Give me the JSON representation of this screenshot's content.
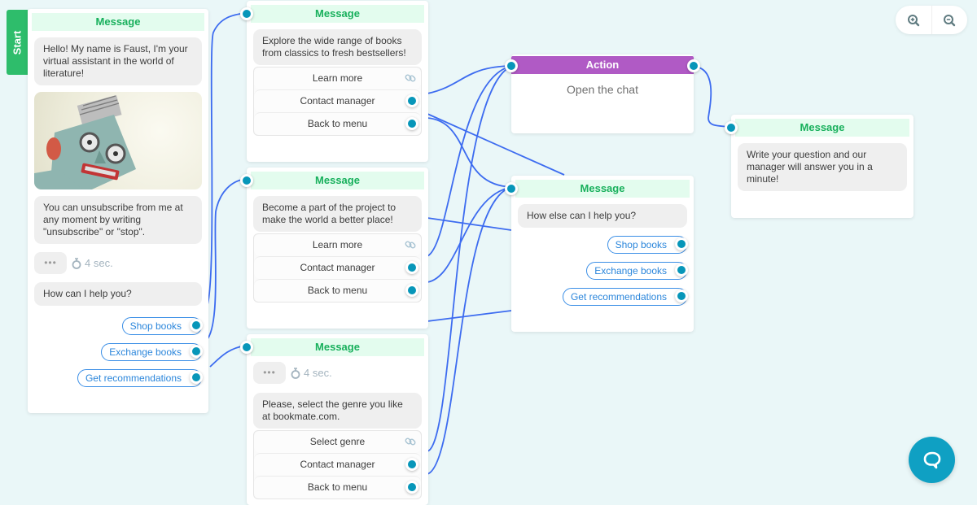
{
  "canvas": {
    "colors": {
      "background": "#eaf7f8",
      "wire": "#3d6cf0",
      "port": "#0796b9",
      "message_header_bg": "#e3fcee",
      "message_header_text": "#18b05c",
      "action_header_bg": "#b05ac5",
      "start_tab": "#2ebd6b",
      "quick_reply": "#2b86db"
    }
  },
  "toolbar": {
    "zoom_in_icon": "zoom-in-icon",
    "zoom_out_icon": "zoom-out-icon"
  },
  "chat_fab": {
    "icon": "chat-bubble-icon"
  },
  "start_node": {
    "start_label": "Start",
    "header": "Message",
    "greeting": "Hello! My name is Faust, I'm your virtual assistant in the world of literature!",
    "image": "robot-image",
    "unsubscribe_text": "You can unsubscribe from me at any moment by writing \"unsubscribe\" or \"stop\".",
    "typing_dots": "•••",
    "delay": "4 sec.",
    "question": "How can I help you?",
    "quick_replies": [
      "Shop books",
      "Exchange books",
      "Get recommendations"
    ]
  },
  "shop_node": {
    "header": "Message",
    "text": "Explore the wide range of books from classics to fresh bestsellers!",
    "buttons": [
      "Learn more",
      "Contact manager",
      "Back to menu"
    ]
  },
  "exchange_node": {
    "header": "Message",
    "text": "Become a part of the project to make the world a better place!",
    "buttons": [
      "Learn more",
      "Contact manager",
      "Back to menu"
    ]
  },
  "recommend_node": {
    "header": "Message",
    "typing_dots": "•••",
    "delay": "4 sec.",
    "text": "Please, select the genre you like at bookmate.com.",
    "buttons": [
      "Select genre",
      "Contact manager",
      "Back to menu"
    ]
  },
  "action_node": {
    "header": "Action",
    "text": "Open the chat"
  },
  "menu_node": {
    "header": "Message",
    "text": "How else can I help you?",
    "quick_replies": [
      "Shop books",
      "Exchange books",
      "Get recommendations"
    ]
  },
  "manager_node": {
    "header": "Message",
    "text": "Write your question and our manager will answer you in a minute!"
  }
}
